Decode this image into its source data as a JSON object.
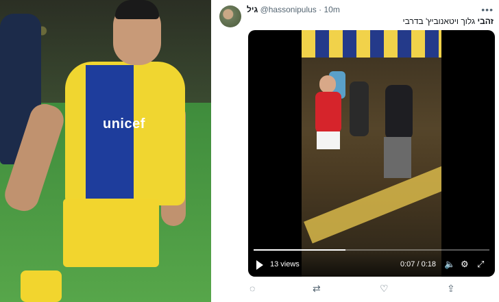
{
  "tweet": {
    "display_name": "גיל",
    "handle": "@hassonipulus",
    "separator": "·",
    "timestamp": "10m",
    "more_icon": "more-icon",
    "text_bold": "זהבי",
    "text": "גלוך ויטאנוביץ' בדרבי"
  },
  "video": {
    "views": "13 views",
    "time": "0:07 / 0:18",
    "progress": 0.39
  },
  "actions": {
    "reply_icon": "reply-icon",
    "retweet_icon": "retweet-icon",
    "like_icon": "like-icon",
    "share_icon": "share-icon"
  },
  "photo": {
    "sponsor": "unicef"
  }
}
